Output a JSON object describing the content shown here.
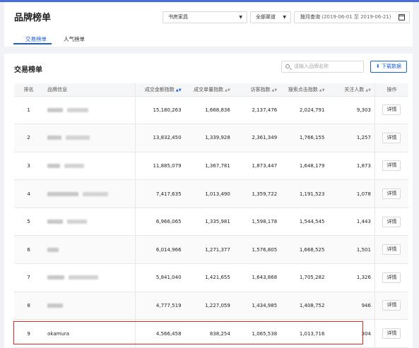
{
  "header": {
    "title": "品牌榜单",
    "category_select": "书房家具",
    "channel_select": "全部渠道",
    "date_mode": "按月查询",
    "date_range": "(2019-06-01 至 2019-06-21)",
    "tabs": [
      {
        "label": "交易榜单",
        "active": true
      },
      {
        "label": "人气榜单",
        "active": false
      }
    ]
  },
  "section": {
    "title": "交易榜单",
    "search_placeholder": "请输入品牌名称",
    "download_label": "下载数据"
  },
  "table": {
    "columns": [
      "排名",
      "品牌信息",
      "成交金额指数",
      "成交单量指数",
      "访客指数",
      "搜索点击指数",
      "关注人数",
      "操作"
    ],
    "detail_label": "详情",
    "rows": [
      {
        "rank": "1",
        "brand": "",
        "amount": "15,180,263",
        "orders": "1,668,836",
        "visitors": "2,137,476",
        "search": "2,024,791",
        "follows": "9,303"
      },
      {
        "rank": "2",
        "brand": "",
        "amount": "13,832,450",
        "orders": "1,339,928",
        "visitors": "2,361,349",
        "search": "1,766,155",
        "follows": "1,257"
      },
      {
        "rank": "3",
        "brand": "",
        "amount": "11,885,079",
        "orders": "1,367,781",
        "visitors": "1,873,447",
        "search": "1,648,179",
        "follows": "1,873"
      },
      {
        "rank": "4",
        "brand": "",
        "amount": "7,417,635",
        "orders": "1,013,490",
        "visitors": "1,359,722",
        "search": "1,191,523",
        "follows": "1,078"
      },
      {
        "rank": "5",
        "brand": "",
        "amount": "6,966,065",
        "orders": "1,335,981",
        "visitors": "1,598,178",
        "search": "1,544,545",
        "follows": "1,443"
      },
      {
        "rank": "6",
        "brand": "",
        "amount": "6,014,966",
        "orders": "1,271,377",
        "visitors": "1,576,805",
        "search": "1,668,525",
        "follows": "1,501"
      },
      {
        "rank": "7",
        "brand": "",
        "amount": "5,841,040",
        "orders": "1,421,655",
        "visitors": "1,643,868",
        "search": "1,705,282",
        "follows": "1,326"
      },
      {
        "rank": "8",
        "brand": "",
        "amount": "4,777,519",
        "orders": "1,227,059",
        "visitors": "1,434,985",
        "search": "1,408,752",
        "follows": "946"
      },
      {
        "rank": "9",
        "brand": "okamura",
        "amount": "4,566,458",
        "orders": "838,254",
        "visitors": "1,065,538",
        "search": "1,013,716",
        "follows": "304"
      }
    ]
  },
  "colors": {
    "accent": "#1f5fd6",
    "highlight_border": "#e0281d"
  }
}
